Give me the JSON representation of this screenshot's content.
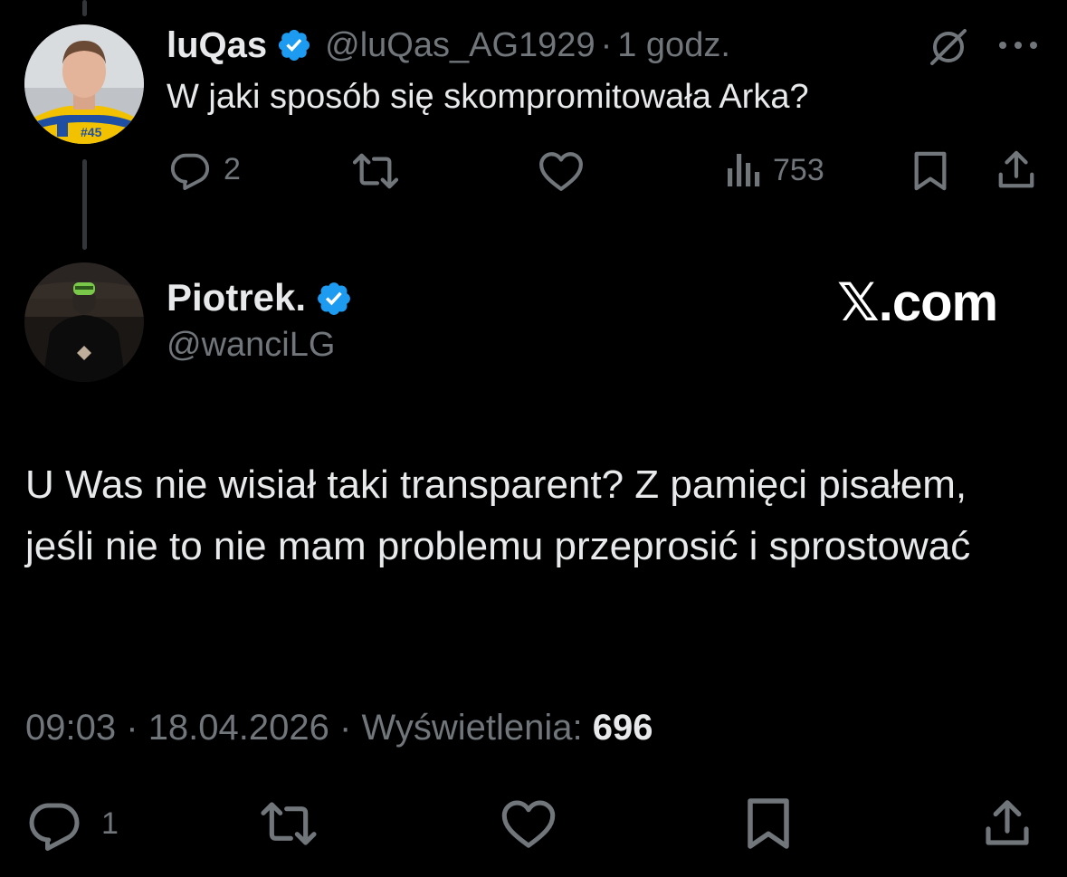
{
  "parent_tweet": {
    "author_name": "luQas",
    "handle": "@luQas_AG1929",
    "separator": "·",
    "time": "1 godz.",
    "text": "W jaki sposób się skompromitowała Arka?",
    "avatar_jersey_number": "#45",
    "stats": {
      "replies": "2",
      "views": "753"
    },
    "icons": [
      "grok-icon",
      "more-icon",
      "reply-icon",
      "retweet-icon",
      "like-icon",
      "views-icon",
      "bookmark-icon",
      "share-icon"
    ]
  },
  "main_tweet": {
    "author_name": "Piotrek.",
    "handle": "@wanciLG",
    "text": "U Was nie wisiał taki transparent? Z pamięci pisałem, jeśli nie to nie mam problemu przeprosić i sprostować",
    "time": "09:03",
    "separator": "·",
    "date": "18.04.2026",
    "views_label": "Wyświetlenia:",
    "views_count": "696",
    "stats": {
      "replies": "1"
    }
  },
  "watermark": "𝕏.com",
  "colors": {
    "background": "#000000",
    "text_primary": "#e7e9ea",
    "text_secondary": "#71767b",
    "verified_blue": "#1d9bf0",
    "thread_line": "#333639"
  }
}
